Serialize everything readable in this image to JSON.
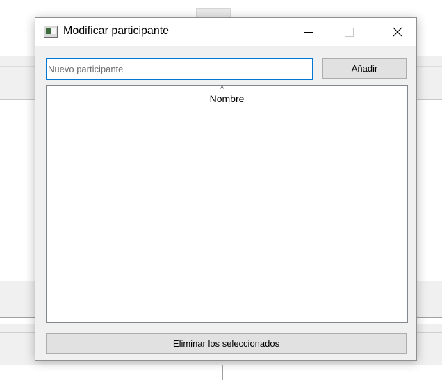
{
  "window": {
    "title": "Modificar participante",
    "icons": {
      "app": "app-window-icon",
      "minimize": "minimize-icon",
      "maximize": "maximize-icon",
      "close": "close-icon"
    },
    "close_glyph": "✕"
  },
  "new_participant": {
    "value": "",
    "placeholder": "Nuevo participante"
  },
  "add_button": {
    "label": "Añadir"
  },
  "participants_list": {
    "columns": [
      {
        "label": "Nombre",
        "sort": "ascending",
        "sort_glyph": "^"
      }
    ],
    "rows": []
  },
  "delete_button": {
    "label": "Eliminar los seleccionados"
  },
  "colors": {
    "focus_border": "#0078d7",
    "button_bg": "#e1e1e1",
    "dialog_bg": "#f0f0f0"
  }
}
